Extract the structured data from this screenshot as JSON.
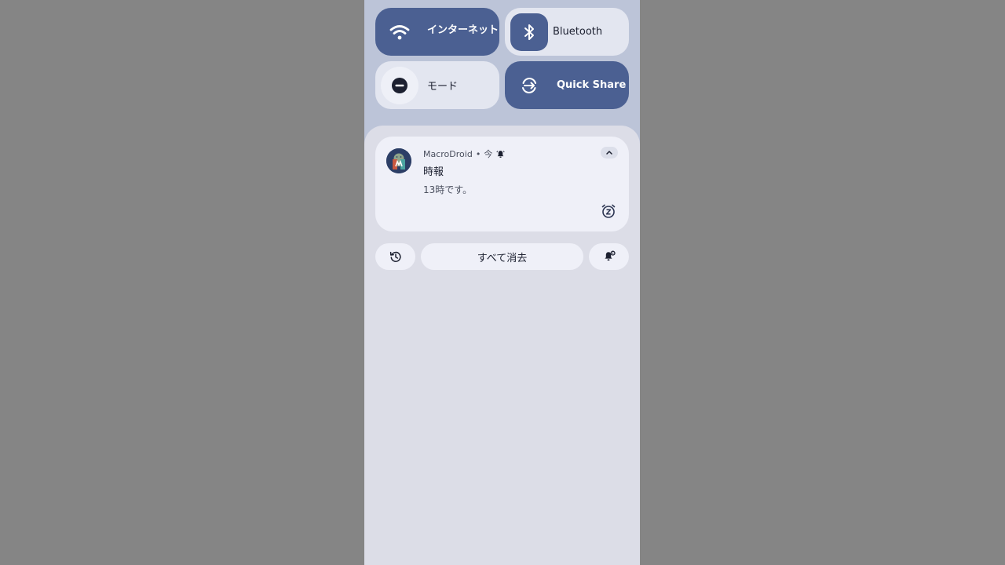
{
  "quick_settings": {
    "tiles": [
      {
        "label": "インターネット",
        "icon": "wifi-icon",
        "state": "on"
      },
      {
        "label": "Bluetooth",
        "icon": "bluetooth-icon",
        "state": "off"
      },
      {
        "label": "モード",
        "icon": "do-not-disturb-icon",
        "state": "off"
      },
      {
        "label": "Quick Share",
        "icon": "quick-share-icon",
        "state": "on"
      }
    ]
  },
  "notification": {
    "app_name": "MacroDroid",
    "separator": "•",
    "time": "今",
    "title": "時報",
    "body": "13時です。"
  },
  "footer": {
    "clear_all_label": "すべて消去"
  },
  "colors": {
    "accent": "#4b6092",
    "tile_off": "#e3e6f0",
    "shade_bg": "#dcdde7",
    "card_bg": "#eff0f8",
    "backdrop": "#858585"
  }
}
